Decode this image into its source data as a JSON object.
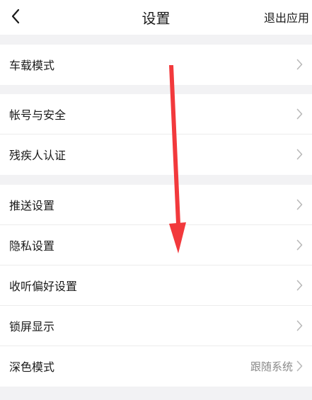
{
  "header": {
    "title": "设置",
    "exit_label": "退出应用",
    "back_icon": "chevron-left-icon"
  },
  "groups": [
    {
      "items": [
        {
          "label": "车载模式"
        }
      ]
    },
    {
      "items": [
        {
          "label": "帐号与安全"
        },
        {
          "label": "残疾人认证"
        }
      ]
    },
    {
      "items": [
        {
          "label": "推送设置"
        },
        {
          "label": "隐私设置"
        },
        {
          "label": "收听偏好设置"
        },
        {
          "label": "锁屏显示"
        },
        {
          "label": "深色模式",
          "value": "跟随系统"
        }
      ]
    }
  ],
  "annotation": {
    "icon": "arrow-down-icon",
    "color": "#f2393c"
  },
  "colors": {
    "background": "#f2f2f4",
    "text": "#1a1a1a",
    "chevron": "#b9b9b9",
    "value": "#8a8a8a"
  }
}
